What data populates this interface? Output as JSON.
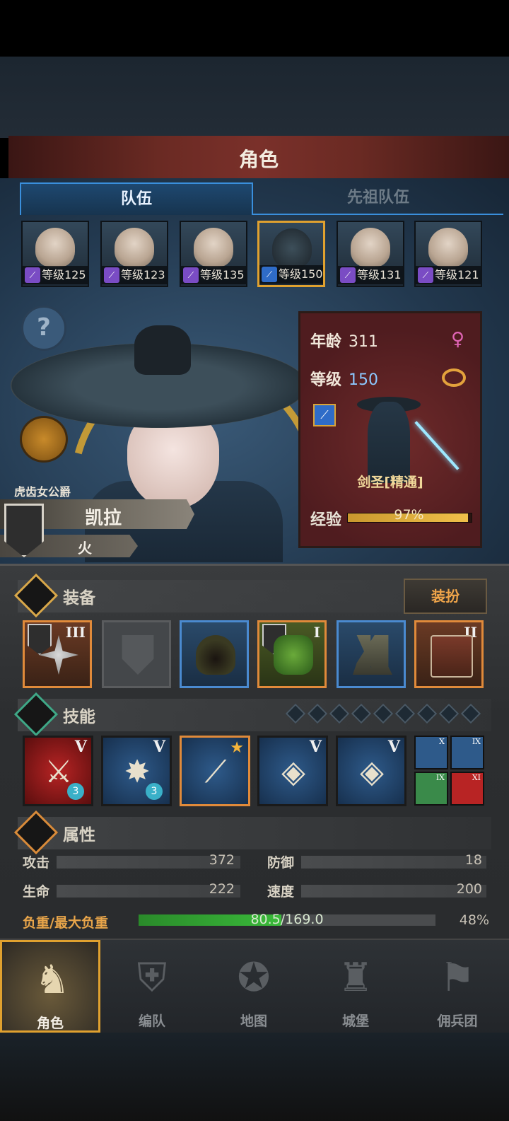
{
  "header": {
    "title": "角色"
  },
  "tabs": [
    {
      "label": "队伍",
      "active": true
    },
    {
      "label": "先祖队伍",
      "active": false
    }
  ],
  "roster": [
    {
      "level": "等级125",
      "selected": false
    },
    {
      "level": "等级123",
      "selected": false
    },
    {
      "level": "等级135",
      "selected": false
    },
    {
      "level": "等级150",
      "selected": true
    },
    {
      "level": "等级131",
      "selected": false
    },
    {
      "level": "等级121",
      "selected": false
    }
  ],
  "character": {
    "title": "虎齿女公爵",
    "name": "凯拉",
    "element": "火",
    "age_label": "年龄",
    "age": "311",
    "level_label": "等级",
    "level": "150",
    "job": "剑圣[精通]",
    "exp_label": "经验",
    "exp": "97%",
    "exp_fraction": 0.97
  },
  "equipment": {
    "section_label": "装备",
    "dress_button": "装扮",
    "slots": [
      {
        "rank": "III",
        "style": "orange"
      },
      {
        "rank": "",
        "style": "empty"
      },
      {
        "rank": "",
        "style": "blue"
      },
      {
        "rank": "I",
        "style": "green"
      },
      {
        "rank": "",
        "style": "blue"
      },
      {
        "rank": "II",
        "style": "orange"
      }
    ]
  },
  "skills": {
    "section_label": "技能",
    "slots": [
      {
        "rank": "V",
        "badge": "3"
      },
      {
        "rank": "V",
        "badge": "3"
      },
      {
        "rank": "",
        "badge": ""
      },
      {
        "rank": "V",
        "badge": ""
      },
      {
        "rank": "V",
        "badge": ""
      }
    ],
    "minis": [
      {
        "rank": "X"
      },
      {
        "rank": "IX"
      },
      {
        "rank": "IX"
      },
      {
        "rank": "XI"
      }
    ]
  },
  "attributes": {
    "section_label": "属性",
    "attack_label": "攻击",
    "attack": "372",
    "defense_label": "防御",
    "defense": "18",
    "hp_label": "生命",
    "hp": "222",
    "speed_label": "速度",
    "speed": "200",
    "load_label": "负重/最大负重",
    "load_text": "80.5/169.0",
    "load_pct": "48%",
    "load_fraction": 0.48
  },
  "nav": [
    {
      "label": "角色",
      "icon": "knight-icon",
      "active": true
    },
    {
      "label": "编队",
      "icon": "helmet-icon",
      "active": false
    },
    {
      "label": "地图",
      "icon": "compass-icon",
      "active": false
    },
    {
      "label": "城堡",
      "icon": "castle-icon",
      "active": false
    },
    {
      "label": "佣兵团",
      "icon": "banner-icon",
      "active": false
    }
  ],
  "colors": {
    "accent": "#e0a12f",
    "tab_border": "#3a8fdc",
    "load_fill": "#3aba3a"
  }
}
